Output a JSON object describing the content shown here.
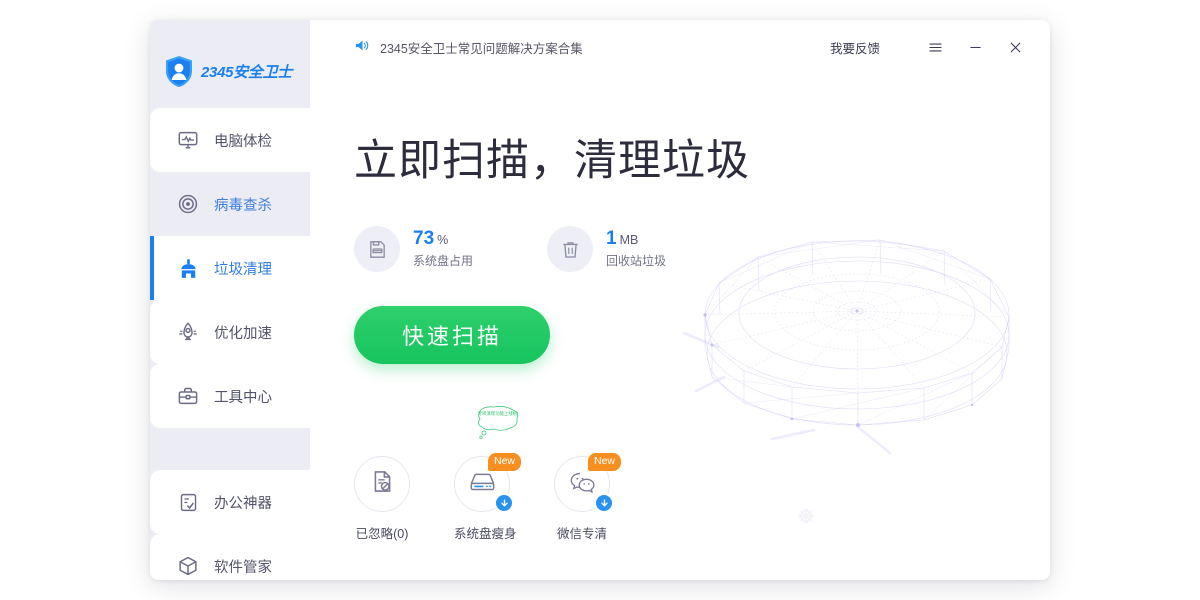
{
  "brand": {
    "logo_text": "2345安全卫士",
    "logo_icon": "shield-person-icon",
    "accent_blue": "#1a7ff0",
    "accent_green": "#16c45e",
    "badge_orange": "#f79020",
    "sidebar_bg": "#ececf4"
  },
  "sidebar": {
    "items": [
      {
        "label": "电脑体检",
        "icon": "monitor-pulse-icon",
        "state": "panel"
      },
      {
        "label": "病毒查杀",
        "icon": "target-icon",
        "state": "link"
      },
      {
        "label": "垃圾清理",
        "icon": "broom-icon",
        "state": "active"
      },
      {
        "label": "优化加速",
        "icon": "rocket-icon",
        "state": "panel"
      },
      {
        "label": "工具中心",
        "icon": "toolbox-icon",
        "state": "panel"
      },
      {
        "label": "办公神器",
        "icon": "checklist-icon",
        "state": "panel"
      },
      {
        "label": "软件管家",
        "icon": "box-icon",
        "state": "panel"
      }
    ]
  },
  "titlebar": {
    "notice_icon": "speaker-icon",
    "notice_text": "2345安全卫士常见问题解决方案合集",
    "feedback_label": "我要反馈",
    "menu_icon": "hamburger-icon",
    "minimize_icon": "minimize-icon",
    "close_icon": "close-icon"
  },
  "main": {
    "headline": "立即扫描，清理垃圾",
    "stats": [
      {
        "icon": "disk-icon",
        "value": "73",
        "unit": "%",
        "caption": "系统盘占用"
      },
      {
        "icon": "trash-icon",
        "value": "1",
        "unit": "MB",
        "caption": "回收站垃圾"
      }
    ],
    "scan_button": "快速扫描",
    "shortcuts": [
      {
        "label": "已忽略(0)",
        "icon": "file-blocked-icon",
        "badge": null,
        "download": false
      },
      {
        "label": "系统盘瘦身",
        "icon": "hard-drive-icon",
        "badge": "New",
        "download": true,
        "bubble": "专项清理功能上线啦!"
      },
      {
        "label": "微信专清",
        "icon": "wechat-icon",
        "badge": "New",
        "download": true
      }
    ]
  }
}
